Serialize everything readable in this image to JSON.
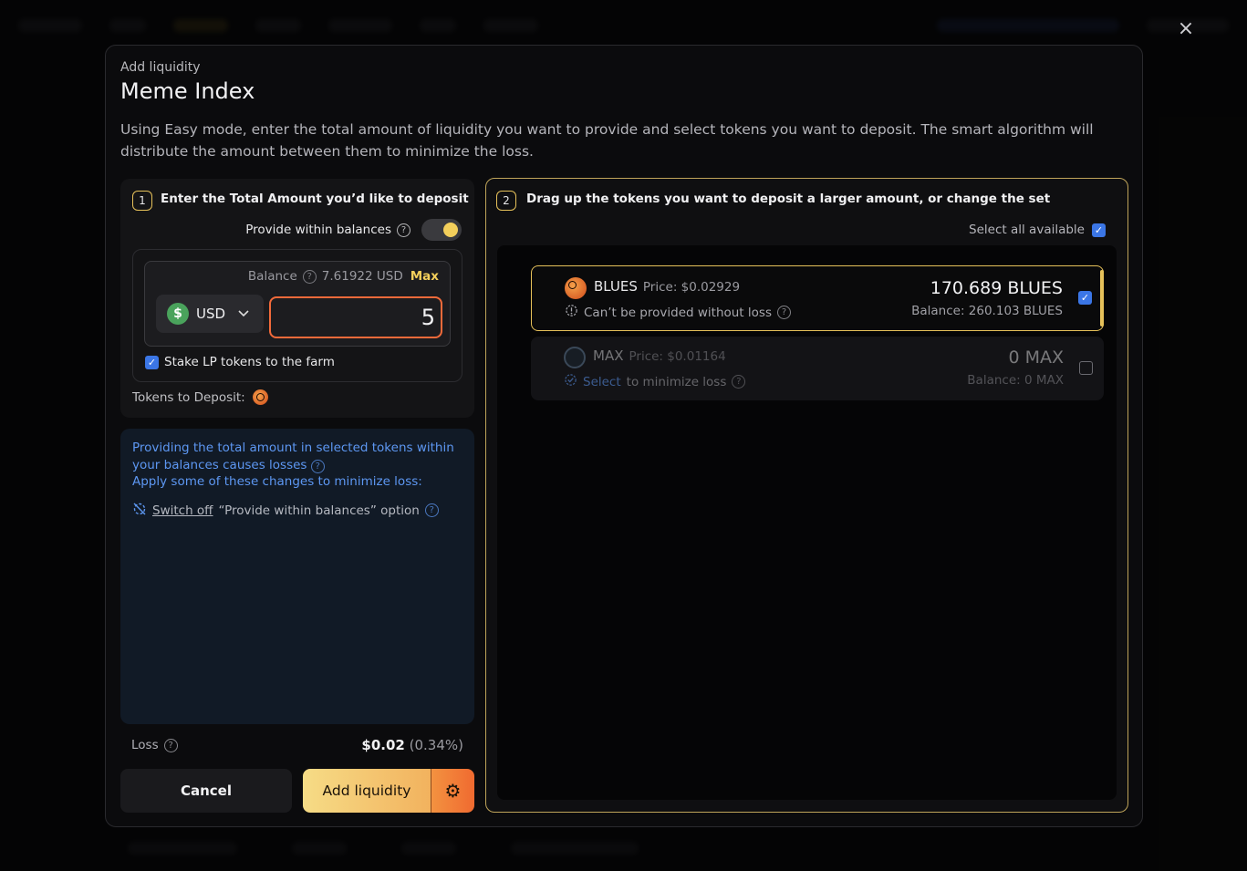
{
  "modal": {
    "subtitle": "Add liquidity",
    "title": "Meme Index",
    "description": "Using Easy mode, enter the total amount of liquidity you want to provide and select tokens you want to deposit. The smart algorithm will distribute the amount between them to minimize the loss.",
    "close_label": "×"
  },
  "step1": {
    "number": "1",
    "title": "Enter the Total Amount you’d like to deposit",
    "provide_within_label": "Provide within balances",
    "provide_within_enabled": true,
    "balance_label": "Balance",
    "balance_value": "7.61922 USD",
    "max_label": "Max",
    "currency": "USD",
    "currency_icon": "$",
    "amount": "5",
    "stake_label": "Stake LP tokens to the farm",
    "stake_checked": true,
    "tokens_to_deposit_label": "Tokens to Deposit:"
  },
  "info": {
    "line1": "Providing the total amount in selected tokens within your balances causes losses",
    "line2": "Apply some of these changes to minimize loss:",
    "switch_link": "Switch off",
    "switch_rest": "“Provide within balances” option"
  },
  "loss": {
    "label": "Loss",
    "value": "$0.02",
    "percent": "(0.34%)"
  },
  "buttons": {
    "cancel": "Cancel",
    "add": "Add liquidity"
  },
  "step2": {
    "number": "2",
    "title": "Drag up the tokens you want to deposit a larger amount, or change the set",
    "select_all_label": "Select all available",
    "select_all_checked": true,
    "tokens": [
      {
        "symbol": "BLUES",
        "price": "Price: $0.02929",
        "note": "Can’t be provided without loss",
        "amount": "170.689 BLUES",
        "balance": "Balance: 260.103 BLUES",
        "checked": true
      },
      {
        "symbol": "MAX",
        "price": "Price: $0.01164",
        "note_link": "Select",
        "note": "to minimize loss",
        "amount": "0 MAX",
        "balance": "Balance: 0 MAX",
        "checked": false
      }
    ]
  },
  "colors": {
    "accent": "#f3cf5b",
    "input_border": "#f26a3a",
    "info_text": "#5d97f2",
    "checkbox": "#3b76e6"
  }
}
